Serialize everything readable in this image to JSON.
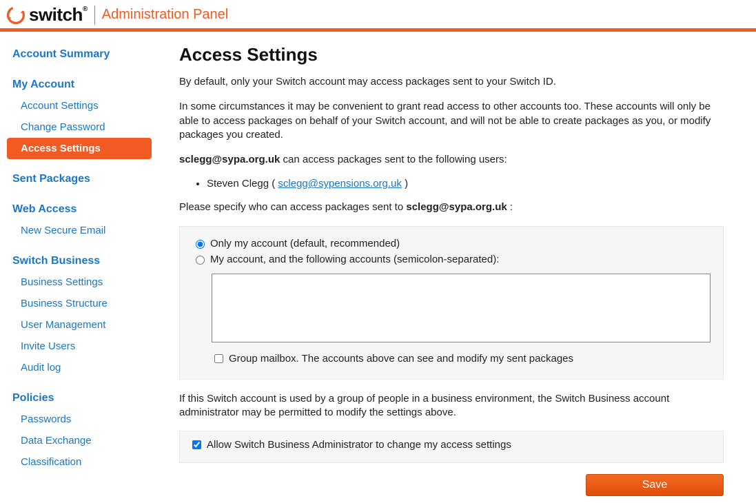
{
  "header": {
    "brand": "switch",
    "brand_reg": "®",
    "admin_title": "Administration Panel"
  },
  "sidebar": {
    "account_summary": "Account Summary",
    "my_account": {
      "title": "My Account",
      "items": [
        "Account Settings",
        "Change Password",
        "Access Settings"
      ],
      "active_index": 2
    },
    "sent_packages": "Sent Packages",
    "web_access": {
      "title": "Web Access",
      "items": [
        "New Secure Email"
      ]
    },
    "switch_business": {
      "title": "Switch Business",
      "items": [
        "Business Settings",
        "Business Structure",
        "User Management",
        "Invite Users",
        "Audit log"
      ]
    },
    "policies": {
      "title": "Policies",
      "items": [
        "Passwords",
        "Data Exchange",
        "Classification"
      ]
    }
  },
  "main": {
    "title": "Access Settings",
    "intro1": "By default, only your Switch account may access packages sent to your Switch ID.",
    "intro2": "In some circumstances it may be convenient to grant read access to other accounts too. These accounts will only be able to access packages on behalf of your Switch account, and will not be able to create packages as you, or modify packages you created.",
    "access_email": "sclegg@sypa.org.uk",
    "access_sentence_suffix": " can access packages sent to the following users:",
    "user_name": "Steven Clegg",
    "user_email": "sclegg@sypensions.org.uk",
    "specify_prefix": "Please specify who can access packages sent to ",
    "specify_suffix": " :",
    "radio_only": "Only my account (default, recommended)",
    "radio_shared": "My account, and the following accounts (semicolon-separated):",
    "accounts_value": "",
    "group_mailbox_label": "Group mailbox. The accounts above can see and modify my sent packages",
    "group_mailbox_checked": false,
    "business_note": "If this Switch account is used by a group of people in a business environment, the Switch Business account administrator may be permitted to modify the settings above.",
    "allow_admin_label": "Allow Switch Business Administrator to change my access settings",
    "allow_admin_checked": true,
    "save_label": "Save",
    "selected_radio": "only"
  }
}
